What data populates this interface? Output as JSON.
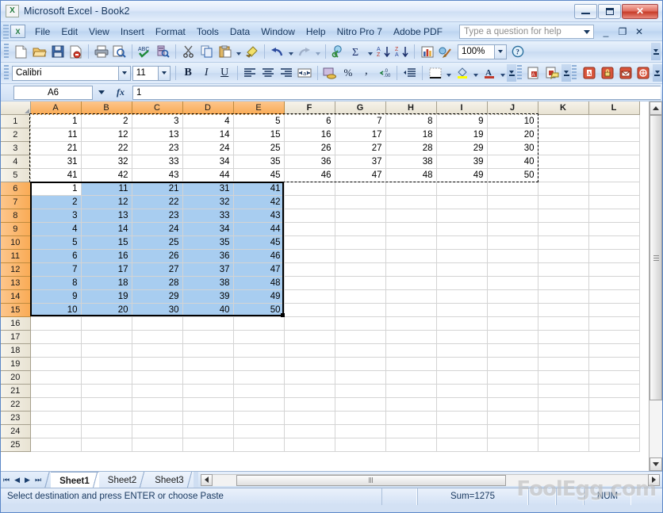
{
  "window": {
    "title": "Microsoft Excel - Book2",
    "app_icon": "excel-icon",
    "minimize_label": "Minimize",
    "restore_label": "Restore",
    "close_label": "Close"
  },
  "menu": {
    "items": [
      {
        "label": "File"
      },
      {
        "label": "Edit"
      },
      {
        "label": "View"
      },
      {
        "label": "Insert"
      },
      {
        "label": "Format"
      },
      {
        "label": "Tools"
      },
      {
        "label": "Data"
      },
      {
        "label": "Window"
      },
      {
        "label": "Help"
      },
      {
        "label": "Nitro Pro 7"
      },
      {
        "label": "Adobe PDF"
      }
    ],
    "help_placeholder": "Type a question for help",
    "help_value": "",
    "win_minimize": "_",
    "win_restore": "❐",
    "win_close": "✕"
  },
  "standard_toolbar": {
    "buttons": [
      {
        "name": "new-icon",
        "title": "New"
      },
      {
        "name": "open-icon",
        "title": "Open"
      },
      {
        "name": "save-icon",
        "title": "Save"
      },
      {
        "name": "permission-icon",
        "title": "Permission"
      },
      {
        "name": "print-icon",
        "title": "Print"
      },
      {
        "name": "print-preview-icon",
        "title": "Print Preview"
      },
      {
        "name": "spelling-icon",
        "title": "Spelling"
      },
      {
        "name": "research-icon",
        "title": "Research"
      },
      {
        "name": "cut-icon",
        "title": "Cut"
      },
      {
        "name": "copy-icon",
        "title": "Copy"
      },
      {
        "name": "paste-icon",
        "title": "Paste"
      },
      {
        "name": "format-painter-icon",
        "title": "Format Painter"
      },
      {
        "name": "undo-icon",
        "title": "Undo"
      },
      {
        "name": "redo-icon",
        "title": "Redo"
      },
      {
        "name": "hyperlink-icon",
        "title": "Insert Hyperlink"
      },
      {
        "name": "autosum-icon",
        "title": "AutoSum"
      },
      {
        "name": "sort-ascending-icon",
        "title": "Sort Ascending"
      },
      {
        "name": "sort-descending-icon",
        "title": "Sort Descending"
      },
      {
        "name": "chart-wizard-icon",
        "title": "Chart Wizard"
      },
      {
        "name": "drawing-icon",
        "title": "Drawing"
      },
      {
        "name": "help-icon",
        "title": "Microsoft Excel Help"
      }
    ],
    "zoom_value": "100%"
  },
  "formatting_toolbar": {
    "font_name": "Calibri",
    "font_size": "11",
    "bold_label": "B",
    "italic_label": "I",
    "underline_label": "U",
    "percent_label": "%",
    "comma_label": ",",
    "buttons": [
      {
        "name": "align-left-icon",
        "title": "Align Left"
      },
      {
        "name": "align-center-icon",
        "title": "Center"
      },
      {
        "name": "align-right-icon",
        "title": "Align Right"
      },
      {
        "name": "merge-and-center-icon",
        "title": "Merge and Center"
      },
      {
        "name": "currency-icon",
        "title": "Currency Style"
      },
      {
        "name": "increase-decimal-icon",
        "title": "Increase Decimal"
      },
      {
        "name": "decrease-indent-icon",
        "title": "Decrease Indent"
      },
      {
        "name": "borders-icon",
        "title": "Borders"
      },
      {
        "name": "fill-color-icon",
        "title": "Fill Color"
      },
      {
        "name": "font-color-icon",
        "title": "Font Color"
      }
    ]
  },
  "pdf_toolbars": {
    "nitro": [
      {
        "name": "convert-to-pdf-icon",
        "title": "Create PDF"
      },
      {
        "name": "create-and-review-pdf-icon",
        "title": "Create PDF and Review"
      }
    ],
    "adobe": [
      {
        "name": "acrobat-convert-icon",
        "title": "Convert to Adobe PDF"
      },
      {
        "name": "acrobat-secure-icon",
        "title": "Convert and Secure"
      },
      {
        "name": "acrobat-email-icon",
        "title": "Convert and Email"
      },
      {
        "name": "acrobat-review-icon",
        "title": "Convert and Send for Review"
      }
    ]
  },
  "formula_bar": {
    "name_box": "A6",
    "fx_label": "fx",
    "formula_value": "1"
  },
  "grid": {
    "columns": [
      "A",
      "B",
      "C",
      "D",
      "E",
      "F",
      "G",
      "H",
      "I",
      "J",
      "K",
      "L"
    ],
    "selected_columns": [
      "A",
      "B",
      "C",
      "D",
      "E"
    ],
    "rows": [
      "1",
      "2",
      "3",
      "4",
      "5",
      "6",
      "7",
      "8",
      "9",
      "10",
      "11",
      "12",
      "13",
      "14",
      "15",
      "16",
      "17",
      "18",
      "19",
      "20",
      "21",
      "22",
      "23",
      "24",
      "25"
    ],
    "selected_rows": [
      "6",
      "7",
      "8",
      "9",
      "10",
      "11",
      "12",
      "13",
      "14",
      "15"
    ],
    "active_cell": "A6",
    "copy_marquee_range": "A1:J5",
    "selection_range": "A6:E15",
    "cell_values": [
      [
        "1",
        "2",
        "3",
        "4",
        "5",
        "6",
        "7",
        "8",
        "9",
        "10",
        "",
        ""
      ],
      [
        "11",
        "12",
        "13",
        "14",
        "15",
        "16",
        "17",
        "18",
        "19",
        "20",
        "",
        ""
      ],
      [
        "21",
        "22",
        "23",
        "24",
        "25",
        "26",
        "27",
        "28",
        "29",
        "30",
        "",
        ""
      ],
      [
        "31",
        "32",
        "33",
        "34",
        "35",
        "36",
        "37",
        "38",
        "39",
        "40",
        "",
        ""
      ],
      [
        "41",
        "42",
        "43",
        "44",
        "45",
        "46",
        "47",
        "48",
        "49",
        "50",
        "",
        ""
      ],
      [
        "1",
        "11",
        "21",
        "31",
        "41",
        "",
        "",
        "",
        "",
        "",
        "",
        ""
      ],
      [
        "2",
        "12",
        "22",
        "32",
        "42",
        "",
        "",
        "",
        "",
        "",
        "",
        ""
      ],
      [
        "3",
        "13",
        "23",
        "33",
        "43",
        "",
        "",
        "",
        "",
        "",
        "",
        ""
      ],
      [
        "4",
        "14",
        "24",
        "34",
        "44",
        "",
        "",
        "",
        "",
        "",
        "",
        ""
      ],
      [
        "5",
        "15",
        "25",
        "35",
        "45",
        "",
        "",
        "",
        "",
        "",
        "",
        ""
      ],
      [
        "6",
        "16",
        "26",
        "36",
        "46",
        "",
        "",
        "",
        "",
        "",
        "",
        ""
      ],
      [
        "7",
        "17",
        "27",
        "37",
        "47",
        "",
        "",
        "",
        "",
        "",
        "",
        ""
      ],
      [
        "8",
        "18",
        "28",
        "38",
        "48",
        "",
        "",
        "",
        "",
        "",
        "",
        ""
      ],
      [
        "9",
        "19",
        "29",
        "39",
        "49",
        "",
        "",
        "",
        "",
        "",
        "",
        ""
      ],
      [
        "10",
        "20",
        "30",
        "40",
        "50",
        "",
        "",
        "",
        "",
        "",
        "",
        ""
      ],
      [
        "",
        "",
        "",
        "",
        "",
        "",
        "",
        "",
        "",
        "",
        "",
        ""
      ],
      [
        "",
        "",
        "",
        "",
        "",
        "",
        "",
        "",
        "",
        "",
        "",
        ""
      ],
      [
        "",
        "",
        "",
        "",
        "",
        "",
        "",
        "",
        "",
        "",
        "",
        ""
      ],
      [
        "",
        "",
        "",
        "",
        "",
        "",
        "",
        "",
        "",
        "",
        "",
        ""
      ],
      [
        "",
        "",
        "",
        "",
        "",
        "",
        "",
        "",
        "",
        "",
        "",
        ""
      ],
      [
        "",
        "",
        "",
        "",
        "",
        "",
        "",
        "",
        "",
        "",
        "",
        ""
      ],
      [
        "",
        "",
        "",
        "",
        "",
        "",
        "",
        "",
        "",
        "",
        "",
        ""
      ],
      [
        "",
        "",
        "",
        "",
        "",
        "",
        "",
        "",
        "",
        "",
        "",
        ""
      ],
      [
        "",
        "",
        "",
        "",
        "",
        "",
        "",
        "",
        "",
        "",
        "",
        ""
      ],
      [
        "",
        "",
        "",
        "",
        "",
        "",
        "",
        "",
        "",
        "",
        "",
        ""
      ]
    ]
  },
  "sheet_tabs": {
    "first_label": "⏮",
    "prev_label": "◀",
    "next_label": "▶",
    "last_label": "⏭",
    "tabs": [
      {
        "label": "Sheet1",
        "active": true
      },
      {
        "label": "Sheet2",
        "active": false
      },
      {
        "label": "Sheet3",
        "active": false
      }
    ]
  },
  "status_bar": {
    "message": "Select destination and press ENTER or choose Paste",
    "sum": "Sum=1275",
    "num_lock": "NUM"
  },
  "watermark": "FoolEgg.com",
  "colors": {
    "header_selected": "#f9ab55",
    "cell_selected": "#a8cdf0",
    "title_text": "#17375e",
    "close_button": "#c73c29"
  }
}
